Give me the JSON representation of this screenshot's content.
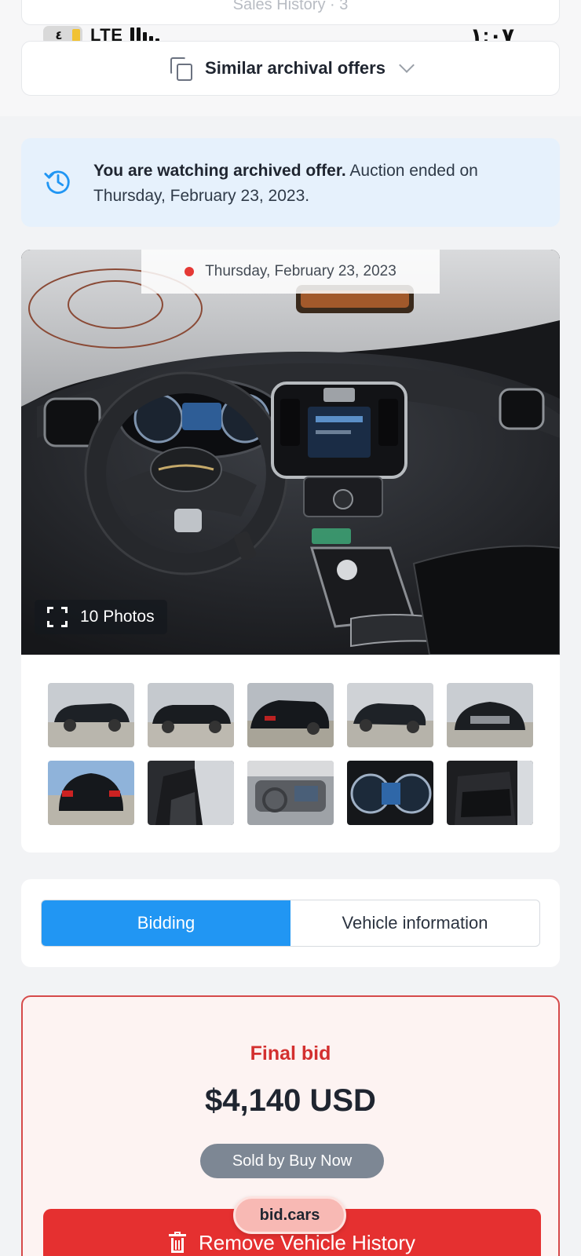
{
  "status_bar": {
    "battery": "٤",
    "network": "LTE",
    "time": "١:٠٧"
  },
  "previous_section": {
    "label": "Sales History · 3"
  },
  "similar_offers": {
    "label": "Similar archival offers",
    "icon": "copy-icon"
  },
  "archived_banner": {
    "bold": "You are watching archived offer.",
    "text": " Auction ended on Thursday, February 23, 2023.",
    "icon": "history-icon",
    "color": "#2196f3"
  },
  "gallery": {
    "date": "Thursday, February 23, 2023",
    "photos_label": "10 Photos",
    "thumbnails": [
      "thumb-1",
      "thumb-2",
      "thumb-3",
      "thumb-4",
      "thumb-5",
      "thumb-6",
      "thumb-7",
      "thumb-8",
      "thumb-9",
      "thumb-10"
    ]
  },
  "tabs": [
    {
      "label": "Bidding",
      "active": true
    },
    {
      "label": "Vehicle information",
      "active": false
    }
  ],
  "bid": {
    "title": "Final bid",
    "amount": "$4,140 USD",
    "status": "Sold by Buy Now",
    "remove_button": "Remove Vehicle History"
  },
  "browser": {
    "url": "bid.cars"
  },
  "colors": {
    "accent": "#2196f3",
    "danger": "#e53030",
    "pill": "#7d8794"
  }
}
